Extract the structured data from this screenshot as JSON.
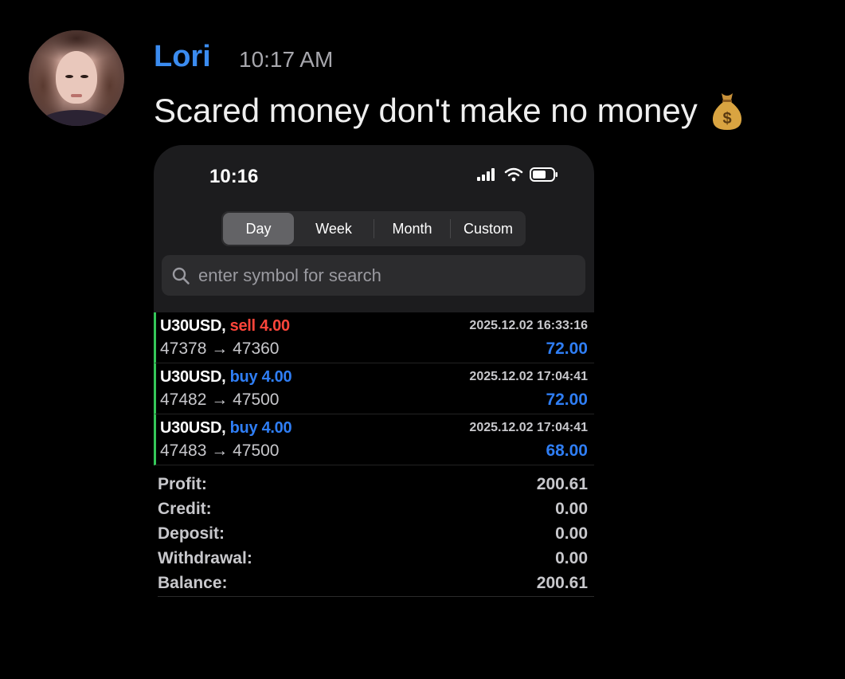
{
  "message": {
    "username": "Lori",
    "timestamp": "10:17 AM",
    "text": "Scared money don't make no money",
    "emoji": "money-bag-emoji"
  },
  "screenshot": {
    "status_time": "10:16",
    "segments": [
      "Day",
      "Week",
      "Month",
      "Custom"
    ],
    "active_segment": "Day",
    "search_placeholder": "enter symbol for search",
    "trades": [
      {
        "symbol": "U30USD,",
        "side": "sell",
        "volume": "4.00",
        "from": "47378",
        "to": "47360",
        "datetime": "2025.12.02 16:33:16",
        "profit": "72.00"
      },
      {
        "symbol": "U30USD,",
        "side": "buy",
        "volume": "4.00",
        "from": "47482",
        "to": "47500",
        "datetime": "2025.12.02 17:04:41",
        "profit": "72.00"
      },
      {
        "symbol": "U30USD,",
        "side": "buy",
        "volume": "4.00",
        "from": "47483",
        "to": "47500",
        "datetime": "2025.12.02 17:04:41",
        "profit": "68.00"
      }
    ],
    "summary": [
      {
        "label": "Profit:",
        "value": "200.61"
      },
      {
        "label": "Credit:",
        "value": "0.00"
      },
      {
        "label": "Deposit:",
        "value": "0.00"
      },
      {
        "label": "Withdrawal:",
        "value": "0.00"
      },
      {
        "label": "Balance:",
        "value": "200.61"
      }
    ]
  },
  "colors": {
    "username": "#3b8cf0",
    "sell": "#ff453a",
    "buy": "#2f7ef5",
    "trade_marker": "#34c759"
  }
}
